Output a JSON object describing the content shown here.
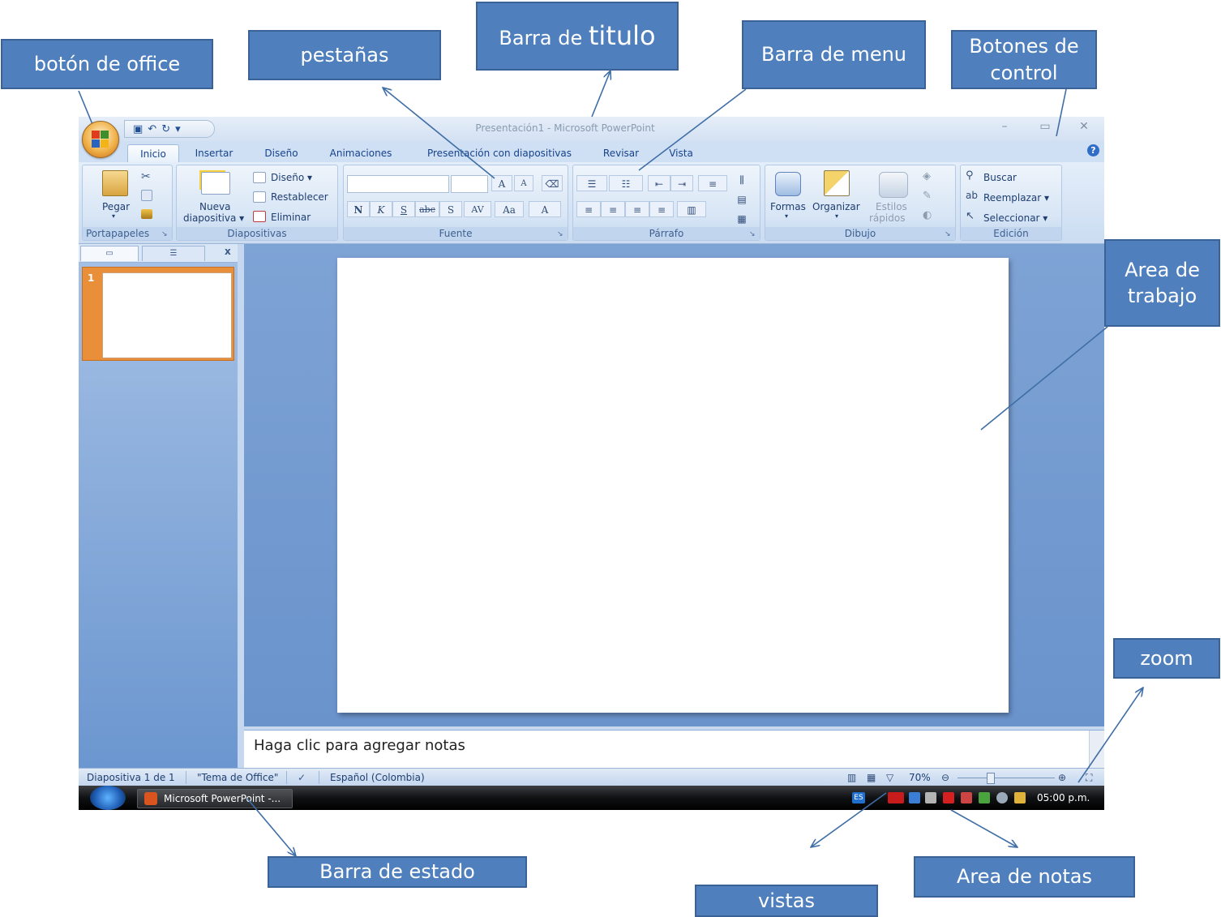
{
  "callouts": {
    "office_button": "botón de office",
    "tabs": "pestañas",
    "title_bar_prefix": "Barra de ",
    "title_bar_big": "titulo",
    "menu_bar": "Barra de menu",
    "control_buttons": "Botones de control",
    "work_area": "Area de trabajo",
    "zoom": "zoom",
    "status_bar": "Barra de estado",
    "views": "vistas",
    "notes_area": "Area de notas"
  },
  "window": {
    "title": "Presentación1 - Microsoft PowerPoint",
    "controls": {
      "minimize": "–",
      "restore": "▭",
      "close": "✕"
    }
  },
  "quick_access": {
    "save_icon": "save-icon",
    "undo_icon": "undo-icon",
    "redo_icon": "redo-icon",
    "customize": "▾"
  },
  "tabs": [
    "Inicio",
    "Insertar",
    "Diseño",
    "Animaciones",
    "Presentación con diapositivas",
    "Revisar",
    "Vista"
  ],
  "ribbon": {
    "clipboard": {
      "paste": "Pegar",
      "label": "Portapapeles"
    },
    "slides": {
      "new_slide_line1": "Nueva",
      "new_slide_line2": "diapositiva ▾",
      "layout": "Diseño ▾",
      "reset": "Restablecer",
      "delete": "Eliminar",
      "label": "Diapositivas"
    },
    "font": {
      "label": "Fuente",
      "bold": "N",
      "italic": "K",
      "underline": "S",
      "strike": "abc",
      "shadow": "S",
      "spacing": "AV",
      "case": "Aa",
      "color": "A",
      "grow": "A",
      "shrink": "A"
    },
    "paragraph": {
      "label": "Párrafo"
    },
    "drawing": {
      "shapes": "Formas",
      "arrange": "Organizar",
      "quick_styles_line1": "Estilos",
      "quick_styles_line2": "rápidos",
      "label": "Dibujo"
    },
    "editing": {
      "find": "Buscar",
      "replace": "Reemplazar ▾",
      "select": "Seleccionar ▾",
      "label": "Edición"
    }
  },
  "panel": {
    "close": "x",
    "slide_number": "1"
  },
  "notes_placeholder": "Haga clic para agregar notas",
  "status": {
    "slide": "Diapositiva 1 de 1",
    "theme": "\"Tema de Office\"",
    "language": "Español (Colombia)",
    "zoom": "70%"
  },
  "taskbar": {
    "app": "Microsoft PowerPoint -...",
    "lang": "ES",
    "clock": "05:00 p.m."
  },
  "colors": {
    "callout_fill": "#4f7fbd",
    "ribbon": "#d7e5f5",
    "work_area": "#7ea3d5",
    "arrow": "#3f6ea6"
  }
}
